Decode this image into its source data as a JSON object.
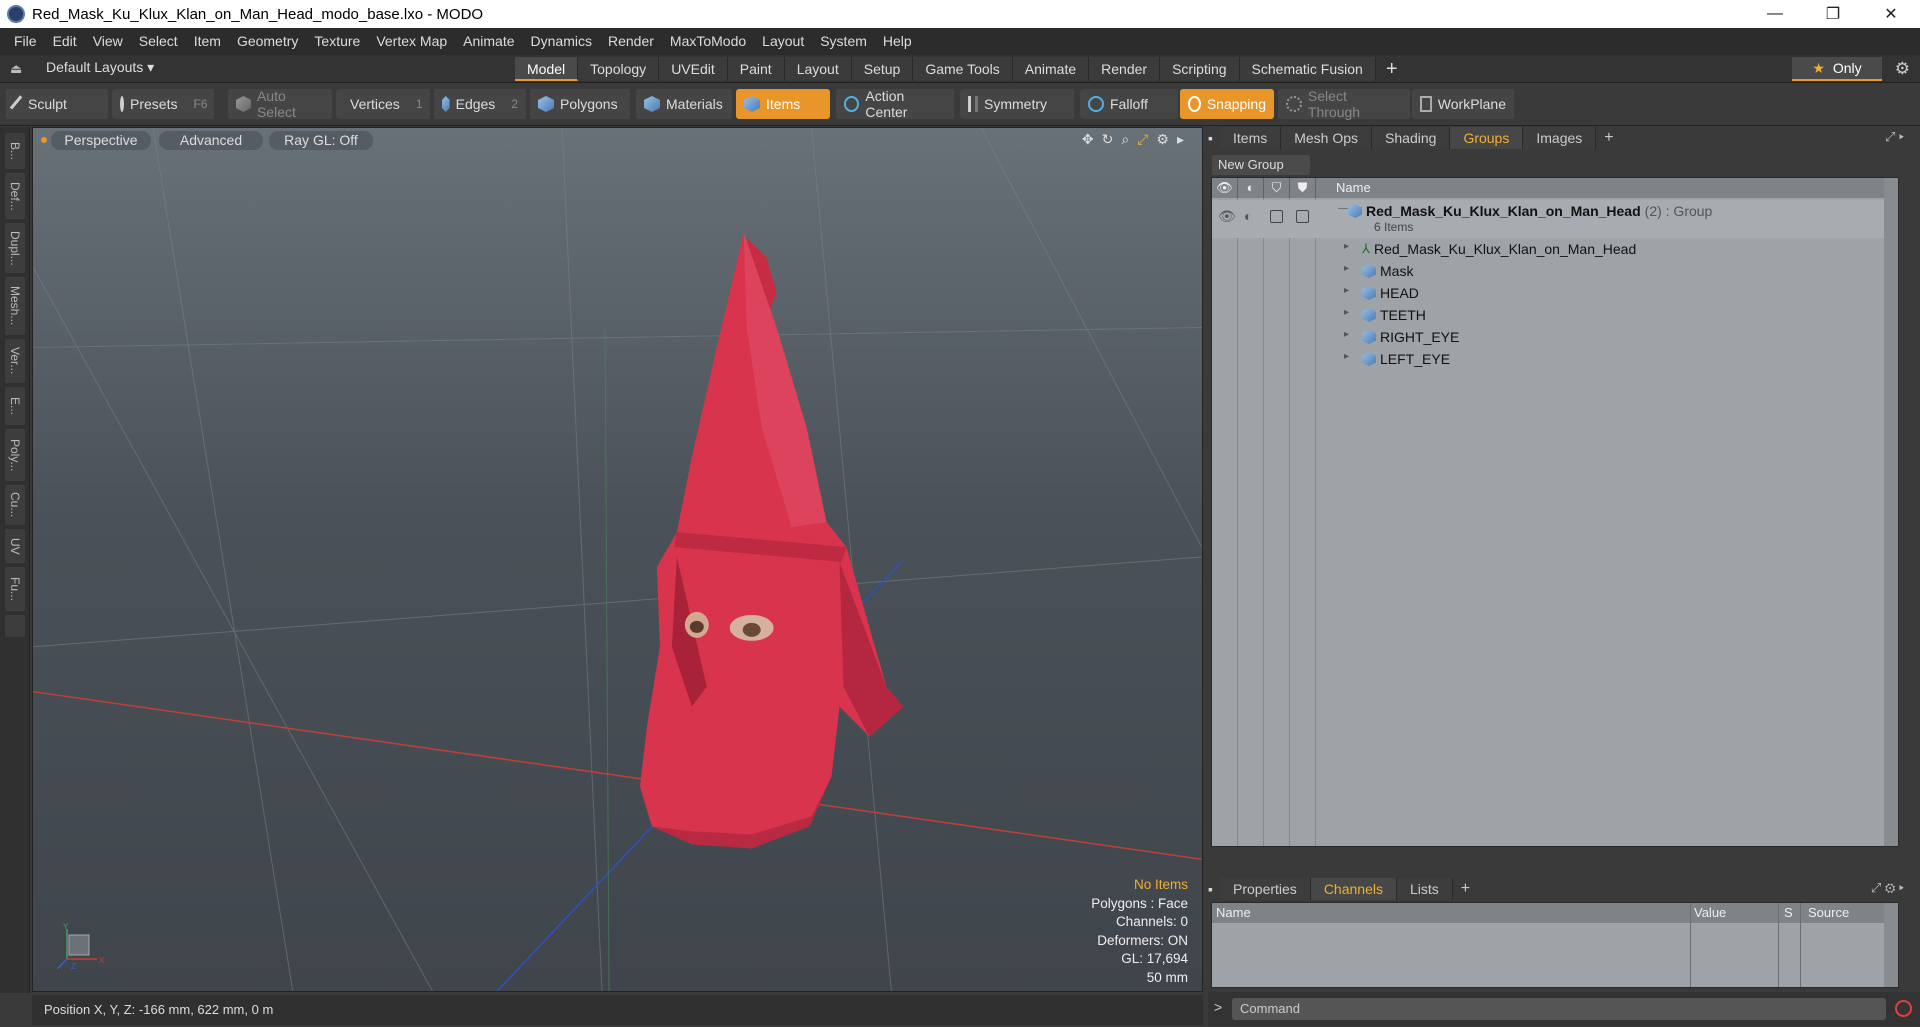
{
  "window": {
    "title": "Red_Mask_Ku_Klux_Klan_on_Man_Head_modo_base.lxo - MODO",
    "minimize": "—",
    "maximize": "❐",
    "close": "✕"
  },
  "menu": [
    "File",
    "Edit",
    "View",
    "Select",
    "Item",
    "Geometry",
    "Texture",
    "Vertex Map",
    "Animate",
    "Dynamics",
    "Render",
    "MaxToModo",
    "Layout",
    "System",
    "Help"
  ],
  "layoutbar": {
    "layout_select": "Default Layouts ▾",
    "tabs": [
      "Model",
      "Topology",
      "UVEdit",
      "Paint",
      "Layout",
      "Setup",
      "Game Tools",
      "Animate",
      "Render",
      "Scripting",
      "Schematic Fusion"
    ],
    "active_tab": "Model",
    "add": "+",
    "only_label": "Only"
  },
  "toolbar": {
    "sculpt": "Sculpt",
    "presets": "Presets",
    "presets_key": "F6",
    "auto_select": "Auto Select",
    "vertices": "Vertices",
    "vertices_num": "1",
    "edges": "Edges",
    "edges_num": "2",
    "polygons": "Polygons",
    "materials": "Materials",
    "items": "Items",
    "action_center": "Action Center",
    "symmetry": "Symmetry",
    "falloff": "Falloff",
    "snapping": "Snapping",
    "select_through": "Select Through",
    "workplane": "WorkPlane"
  },
  "left_strip": [
    "B...",
    "Def...",
    "Dupl...",
    "Mesh...",
    "Ver...",
    "E...",
    "Poly...",
    "Cu...",
    "UV",
    "Fu..."
  ],
  "viewport": {
    "perspective": "Perspective",
    "advanced": "Advanced",
    "raygl": "Ray GL: Off",
    "info": {
      "no_items": "No Items",
      "polygons": "Polygons : Face",
      "channels": "Channels: 0",
      "deformers": "Deformers: ON",
      "gl": "GL: 17,694",
      "scale": "50 mm"
    },
    "axis_y": "Y",
    "axis_x": "X",
    "axis_z": "Z"
  },
  "status": {
    "position": "Position X, Y, Z:   -166 mm, 622 mm, 0 m"
  },
  "right_panel": {
    "tabs": [
      "Items",
      "Mesh Ops",
      "Shading",
      "Groups",
      "Images"
    ],
    "active_tab": "Groups",
    "add": "+",
    "new_group": "New Group",
    "name_header": "Name",
    "group": {
      "name": "Red_Mask_Ku_Klux_Klan_on_Man_Head",
      "suffix": "(2) : Group",
      "count": "6 Items"
    },
    "children": [
      "Red_Mask_Ku_Klux_Klan_on_Man_Head",
      "Mask",
      "HEAD",
      "TEETH",
      "RIGHT_EYE",
      "LEFT_EYE"
    ],
    "bottom_tabs": [
      "Properties",
      "Channels",
      "Lists"
    ],
    "bottom_active": "Channels",
    "channel_headers": {
      "name": "Name",
      "value": "Value",
      "s": "S",
      "source": "Source"
    },
    "command_placeholder": "Command"
  },
  "colors": {
    "accent": "#e8962a",
    "mask_red": "#d8344e",
    "highlight_text": "#f0b030"
  }
}
